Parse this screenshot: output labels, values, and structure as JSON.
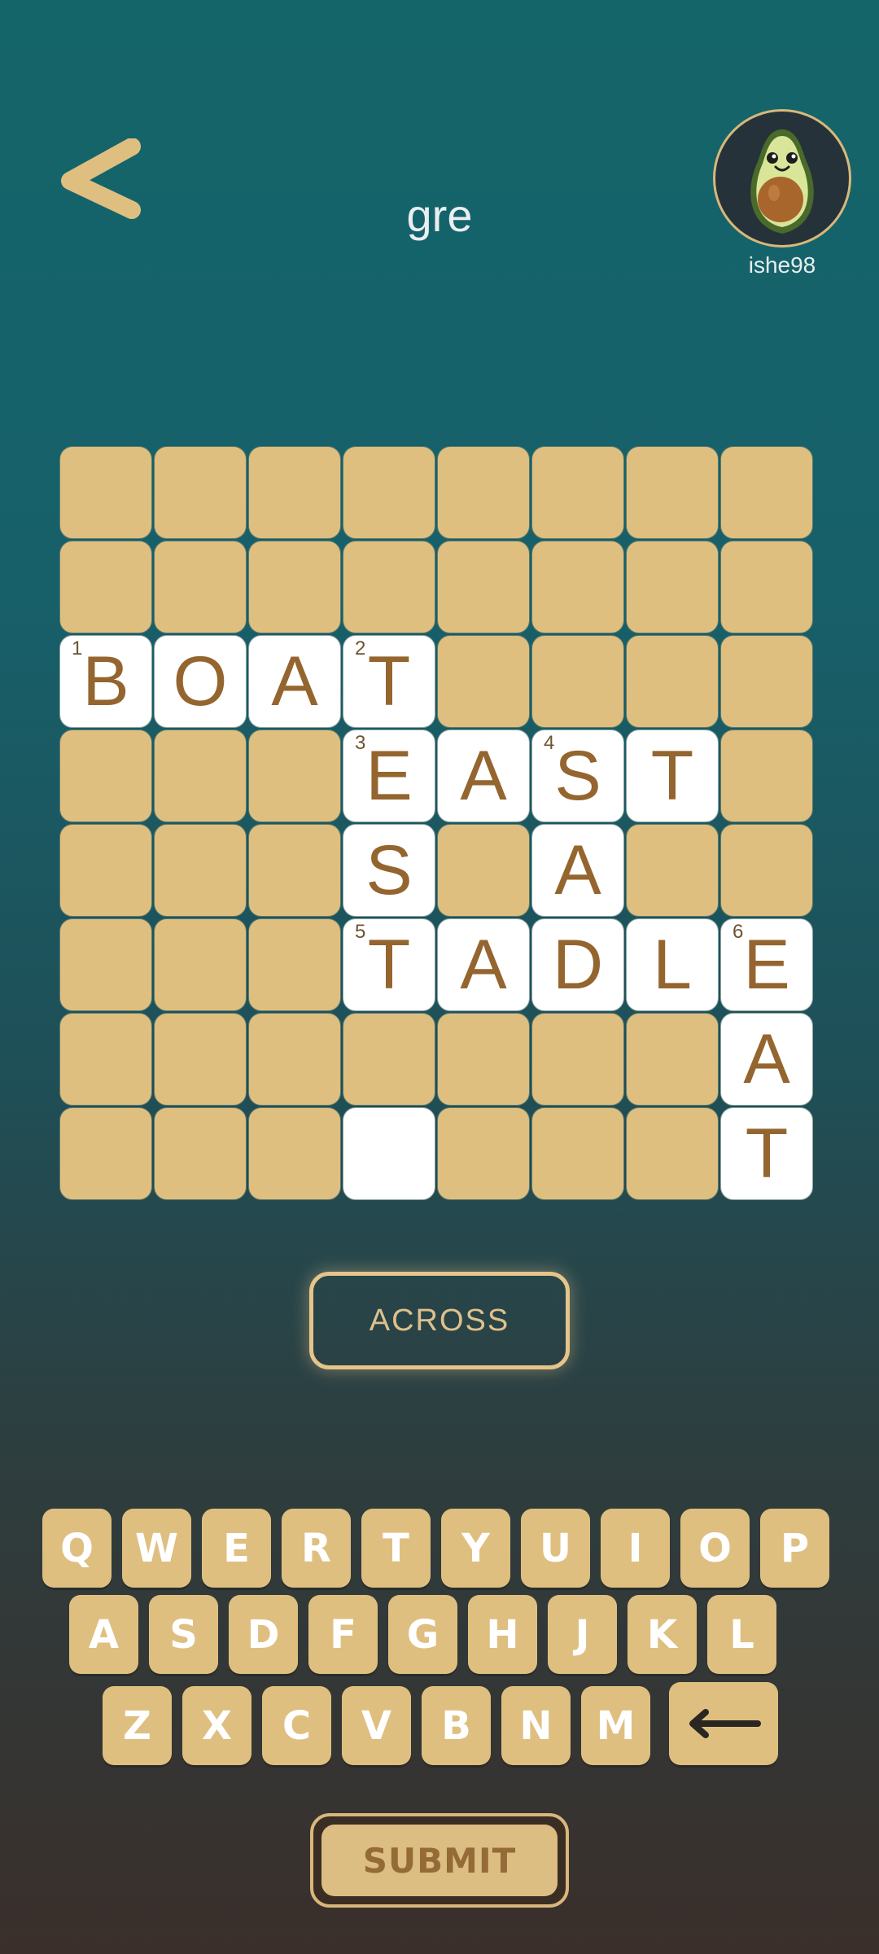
{
  "header": {
    "title": "gre",
    "username": "ishe98"
  },
  "grid": {
    "rows": 8,
    "cols": 8,
    "cells": [
      {
        "r": 2,
        "c": 0,
        "letter": "B",
        "num": "1"
      },
      {
        "r": 2,
        "c": 1,
        "letter": "O"
      },
      {
        "r": 2,
        "c": 2,
        "letter": "A"
      },
      {
        "r": 2,
        "c": 3,
        "letter": "T",
        "num": "2"
      },
      {
        "r": 3,
        "c": 3,
        "letter": "E",
        "num": "3"
      },
      {
        "r": 3,
        "c": 4,
        "letter": "A"
      },
      {
        "r": 3,
        "c": 5,
        "letter": "S",
        "num": "4"
      },
      {
        "r": 3,
        "c": 6,
        "letter": "T"
      },
      {
        "r": 4,
        "c": 3,
        "letter": "S"
      },
      {
        "r": 4,
        "c": 5,
        "letter": "A"
      },
      {
        "r": 5,
        "c": 3,
        "letter": "T",
        "num": "5"
      },
      {
        "r": 5,
        "c": 4,
        "letter": "A"
      },
      {
        "r": 5,
        "c": 5,
        "letter": "D"
      },
      {
        "r": 5,
        "c": 6,
        "letter": "L"
      },
      {
        "r": 5,
        "c": 7,
        "letter": "E",
        "num": "6"
      },
      {
        "r": 6,
        "c": 7,
        "letter": "A"
      },
      {
        "r": 7,
        "c": 3,
        "letter": ""
      },
      {
        "r": 7,
        "c": 7,
        "letter": "T"
      }
    ]
  },
  "direction_label": "ACROSS",
  "keyboard": {
    "rows": [
      [
        "Q",
        "W",
        "E",
        "R",
        "T",
        "Y",
        "U",
        "I",
        "O",
        "P"
      ],
      [
        "A",
        "S",
        "D",
        "F",
        "G",
        "H",
        "J",
        "K",
        "L"
      ],
      [
        "Z",
        "X",
        "C",
        "V",
        "B",
        "N",
        "M"
      ]
    ],
    "backspace_icon": "backspace-arrow-icon"
  },
  "submit_label": "SUBMIT",
  "icons": {
    "back": "back-chevron-icon",
    "avatar": "avocado-avatar-icon"
  },
  "colors": {
    "tile": "#dfbf80",
    "letter": "#94652f",
    "accent": "#e6c48a"
  }
}
